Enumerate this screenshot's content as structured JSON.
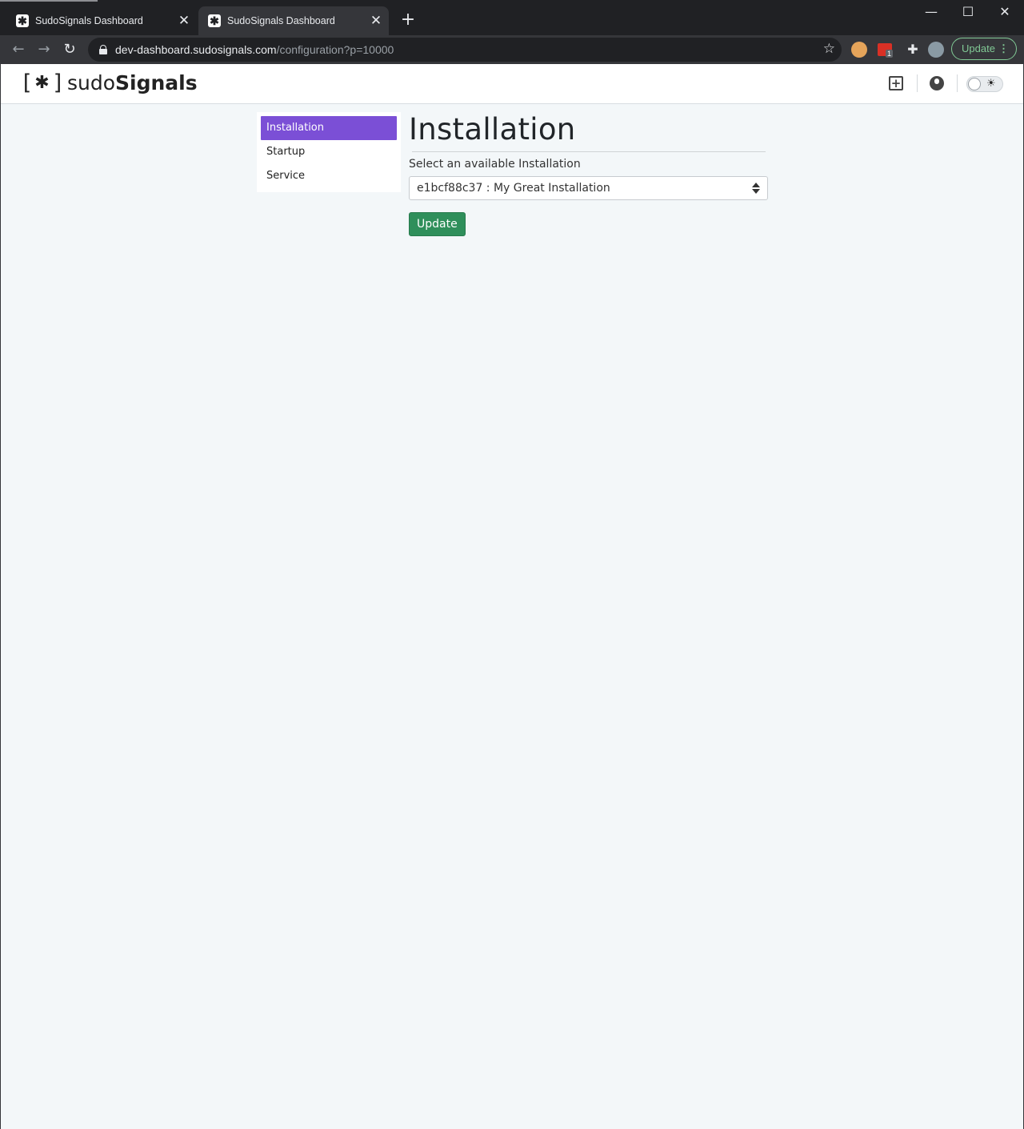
{
  "browser": {
    "tabs": [
      {
        "title": "SudoSignals Dashboard",
        "favicon": "sudosignals-favicon",
        "active": false
      },
      {
        "title": "SudoSignals Dashboard",
        "favicon": "sudosignals-favicon",
        "active": true
      }
    ],
    "url_host": "dev-dashboard.sudosignals.com",
    "url_path": "/configuration?p=10000",
    "update_label": "Update",
    "extension_badge": "1",
    "colors": {
      "update_accent": "#81c995"
    }
  },
  "header": {
    "logo_bracket_open": "[",
    "logo_mark": "✱",
    "logo_bracket_close": "]",
    "logo_sudo": "sudo",
    "logo_signals": "Signals",
    "icons": [
      "add-box-icon",
      "user-icon",
      "theme-toggle"
    ]
  },
  "sidebar": {
    "items": [
      {
        "label": "Installation",
        "active": true
      },
      {
        "label": "Startup",
        "active": false
      },
      {
        "label": "Service",
        "active": false
      }
    ],
    "colors": {
      "active_bg": "#7b4fd6"
    }
  },
  "main": {
    "title": "Installation",
    "select_label": "Select an available Installation",
    "select_value": "e1bcf88c37 : My Great Installation",
    "button_label": "Update",
    "colors": {
      "button_bg": "#2f8f5b"
    }
  }
}
